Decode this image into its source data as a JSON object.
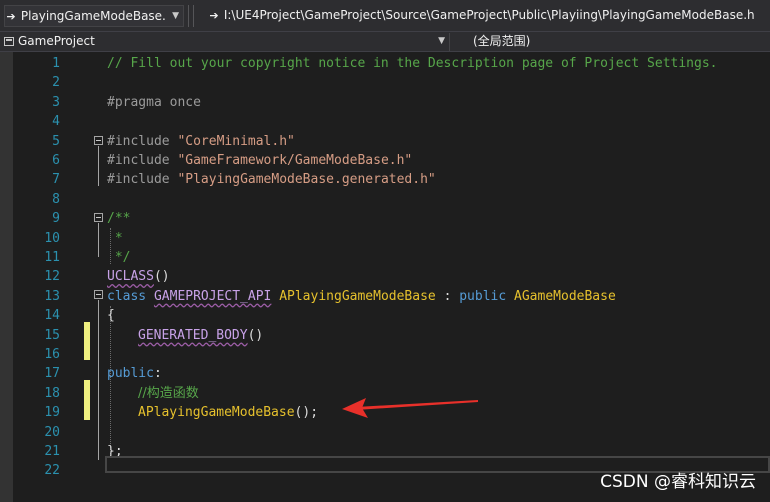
{
  "toolbar": {
    "file_combo": "PlayingGameModeBase.",
    "path": "I:\\UE4Project\\GameProject\\Source\\GameProject\\Public\\Playiing\\PlayingGameModeBase.h"
  },
  "navbar": {
    "project": "GameProject",
    "scope": "(全局范围)"
  },
  "editor": {
    "line_numbers": [
      "1",
      "2",
      "3",
      "4",
      "5",
      "6",
      "7",
      "8",
      "9",
      "10",
      "11",
      "12",
      "13",
      "14",
      "15",
      "16",
      "17",
      "18",
      "19",
      "20",
      "21",
      "22"
    ],
    "lines": {
      "l1": "// Fill out your copyright notice in the Description page of Project Settings.",
      "l3": "#pragma once",
      "l5a": "#include ",
      "l5b": "\"CoreMinimal.h\"",
      "l6a": "#include ",
      "l6b": "\"GameFramework/GameModeBase.h\"",
      "l7a": "#include ",
      "l7b": "\"PlayingGameModeBase.generated.h\"",
      "l9": "/**",
      "l10": " *",
      "l11": " */",
      "l12a": "UCLASS",
      "l12b": "()",
      "l13a": "class ",
      "l13b": "GAMEPROJECT_API",
      "l13c": " ",
      "l13d": "APlayingGameModeBase",
      "l13e": " : ",
      "l13f": "public",
      "l13g": " ",
      "l13h": "AGameModeBase",
      "l14": "{",
      "l15a": "GENERATED_BODY",
      "l15b": "()",
      "l17a": "public",
      "l17b": ":",
      "l18": "//构造函数",
      "l19a": "APlayingGameModeBase",
      "l19b": "();",
      "l21": "};"
    }
  },
  "colors": {
    "annotation_arrow": "#e8302a"
  },
  "watermark": "CSDN @睿科知识云"
}
